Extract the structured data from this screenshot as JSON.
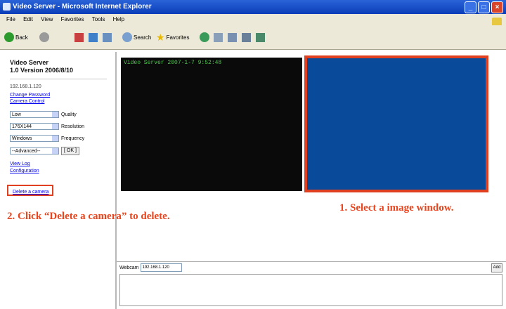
{
  "window": {
    "title": "Video Server - Microsoft Internet Explorer"
  },
  "menu": [
    "File",
    "Edit",
    "View",
    "Favorites",
    "Tools",
    "Help"
  ],
  "toolbar": {
    "back": "Back",
    "search": "Search",
    "favorites": "Favorites"
  },
  "sidebar": {
    "title_line1": "Video Server",
    "title_line2": "1.0 Version 2006/8/10",
    "ip": "192.168.1.120",
    "links": {
      "change_password": "Change Password",
      "camera_control": "Camera Control"
    },
    "controls": [
      {
        "value": "Low",
        "label": "Quality"
      },
      {
        "value": "176X144",
        "label": "Resolution"
      },
      {
        "value": "Windows",
        "label": "Frequency"
      }
    ],
    "advanced": {
      "value": "--Advanced--",
      "button": "[ OK ]"
    },
    "links2": {
      "view_log": "View Log",
      "configuration": "Configuration"
    },
    "delete_camera": "Delete a camera"
  },
  "video": {
    "osd": "Video Server  2007-1-7 9:52:48"
  },
  "annotations": {
    "step1": "1. Select a image window.",
    "step2": "2. Click “Delete a camera” to delete."
  },
  "bottom": {
    "label": "Webcam",
    "address": "192.168.1.120",
    "go": "Add"
  },
  "colors": {
    "highlight": "#e04020",
    "selected_window": "#0a4a9a",
    "osd_text": "#4fc54f"
  }
}
